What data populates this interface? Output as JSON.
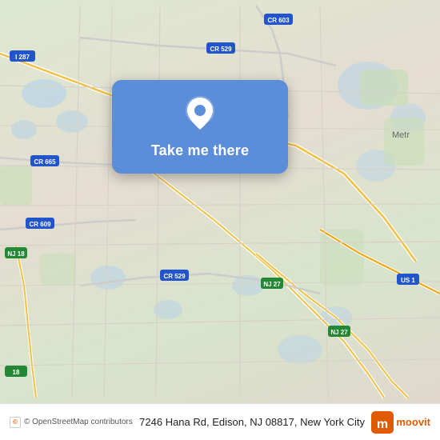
{
  "map": {
    "center_lat": 40.5193,
    "center_lng": -74.3882,
    "zoom": 12
  },
  "location_card": {
    "button_label": "Take me there",
    "pin_color": "#fff"
  },
  "address": {
    "full": "7246 Hana Rd, Edison, NJ 08817, New York City"
  },
  "attribution": {
    "text": "© OpenStreetMap contributors"
  },
  "moovit": {
    "label": "moovit"
  },
  "road_labels": {
    "i287": "I 287",
    "nj27a": "NJ 27",
    "nj27b": "NJ 27",
    "us1": "US 1",
    "nj18": "NJ 18",
    "cr529a": "CR 529",
    "cr529b": "CR 529",
    "cr603": "CR 603",
    "cr665": "CR 665",
    "cr609": "CR 609"
  }
}
